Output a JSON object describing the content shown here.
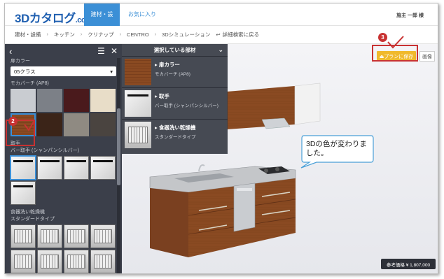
{
  "header": {
    "logo_main": "3Dカタログ",
    "logo_suffix": ".com",
    "tabs": [
      {
        "label": "建材・設備",
        "active": true
      },
      {
        "label": "お気に入り",
        "active": false
      }
    ],
    "user": "施主 一郎 様"
  },
  "breadcrumb": {
    "items": [
      "建材・設備",
      "キッチン",
      "クリナップ",
      "CENTRO",
      "3Dシミュレーション"
    ],
    "back_label": "詳細検索に戻る"
  },
  "sidebar": {
    "door_color_label": "扉カラー",
    "class_select": "05クラス",
    "current_swatch_label": "モカバーチ (AP8)",
    "handle_label": "取手",
    "handle_sub": "バー取手 (シャンパンシルバー)",
    "dryer_label": "食器洗い乾燥機",
    "dryer_sub": "スタンダードタイプ",
    "swatches": [
      {
        "name": "light-grey",
        "color": "#c9ccd1"
      },
      {
        "name": "mid-grey",
        "color": "#7c8087"
      },
      {
        "name": "dark-red",
        "color": "#4a1a1c"
      },
      {
        "name": "beige",
        "color": "#e8ddc8"
      },
      {
        "name": "mocha-birch",
        "color": "#8a4a22"
      },
      {
        "name": "dark-wood",
        "color": "#3b2418"
      },
      {
        "name": "stone-grey",
        "color": "#8f8a82"
      },
      {
        "name": "dark-stone",
        "color": "#4a4440"
      }
    ]
  },
  "parts_panel": {
    "title": "選択している部材",
    "items": [
      {
        "title": "扉カラー",
        "sub": "モカバーチ (AP8)"
      },
      {
        "title": "取手",
        "sub": "バー取手 (シャンパンシルバー)"
      },
      {
        "title": "食器洗い乾燥機",
        "sub": "スタンダードタイプ"
      }
    ]
  },
  "view": {
    "plan_button": "プランに保存",
    "image_button": "画像",
    "price": "参考価格 ¥ 1,807,000",
    "bubble_text": "3Dの色が変わりました。"
  },
  "markers": {
    "step2": "2",
    "step3": "3"
  },
  "colors": {
    "accent": "#3b8fd6",
    "highlight": "#c83232",
    "plan_button": "#f0b92c",
    "sidebar_bg": "#3b3f4a",
    "wood": "#8a4a22"
  }
}
